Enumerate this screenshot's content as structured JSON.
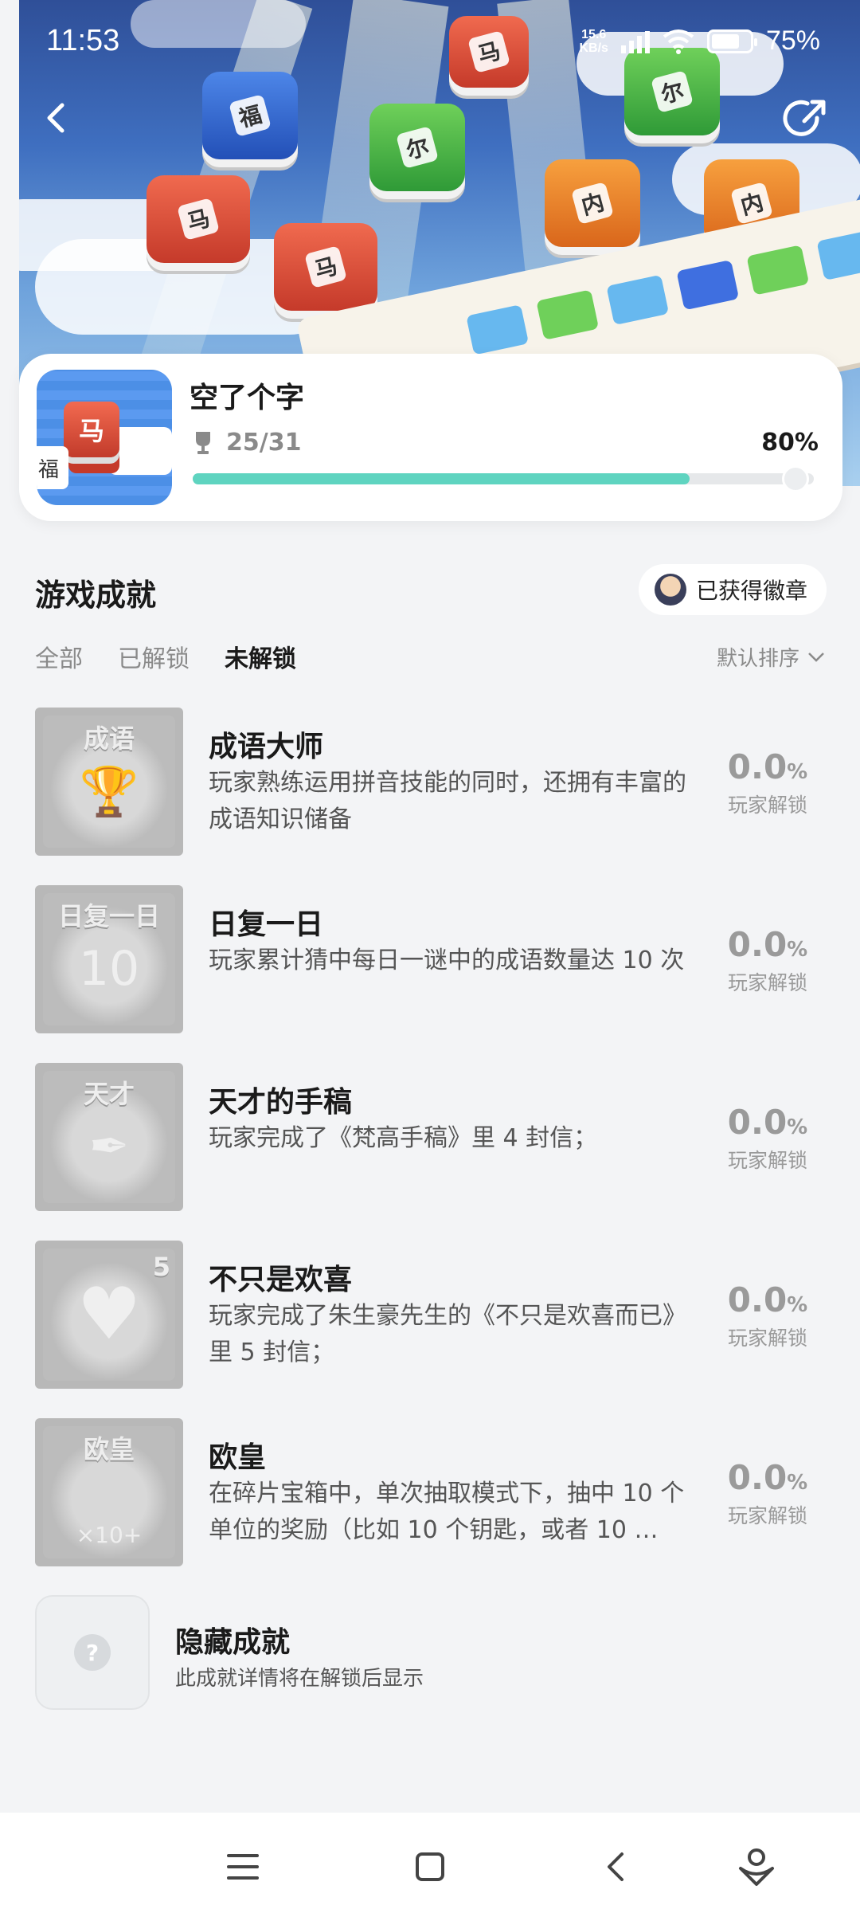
{
  "status_bar": {
    "time": "11:53",
    "net_speed_value": "15.6",
    "net_speed_unit": "KB/s",
    "battery_percent": "75%",
    "battery_level": 0.75
  },
  "game": {
    "title": "空了个字",
    "progress_text": "25/31",
    "progress_percent": "80%",
    "progress_fraction": 0.8,
    "icon_key_char": "马",
    "icon_side_char": "福"
  },
  "section": {
    "title": "游戏成就",
    "badge_button_label": "已获得徽章",
    "tabs": [
      {
        "label": "全部"
      },
      {
        "label": "已解锁"
      },
      {
        "label": "未解锁"
      }
    ],
    "active_tab": "未解锁",
    "sort_label": "默认排序"
  },
  "achievements": [
    {
      "title": "成语大师",
      "desc": "玩家熟练运用拼音技能的同时，还拥有丰富的成语知识储备",
      "percent": "0.0",
      "percent_unit": "%",
      "caption": "玩家解锁",
      "thumb_label": "成语",
      "thumb_glyph": "🏆"
    },
    {
      "title": "日复一日",
      "desc": "玩家累计猜中每日一谜中的成语数量达 10 次",
      "percent": "0.0",
      "percent_unit": "%",
      "caption": "玩家解锁",
      "thumb_label": "日复一日",
      "thumb_glyph": "10"
    },
    {
      "title": "天才的手稿",
      "desc": "玩家完成了《梵高手稿》里 4 封信；",
      "percent": "0.0",
      "percent_unit": "%",
      "caption": "玩家解锁",
      "thumb_label": "天才",
      "thumb_glyph": "✒"
    },
    {
      "title": "不只是欢喜",
      "desc": "玩家完成了朱生豪先生的《不只是欢喜而已》里 5 封信；",
      "percent": "0.0",
      "percent_unit": "%",
      "caption": "玩家解锁",
      "thumb_label": "5",
      "thumb_glyph": "♥"
    },
    {
      "title": "欧皇",
      "desc": "在碎片宝箱中，单次抽取模式下，抽中 10 个单位的奖励（比如 10 个钥匙，或者 10 …",
      "percent": "0.0",
      "percent_unit": "%",
      "caption": "玩家解锁",
      "thumb_label": "欧皇",
      "thumb_glyph": "×10+"
    }
  ],
  "hidden": {
    "title": "隐藏成就",
    "desc": "此成就详情将在解锁后显示",
    "icon_char": "?"
  },
  "colors": {
    "progress": "#5fd4c0",
    "background": "#f3f4f6"
  }
}
